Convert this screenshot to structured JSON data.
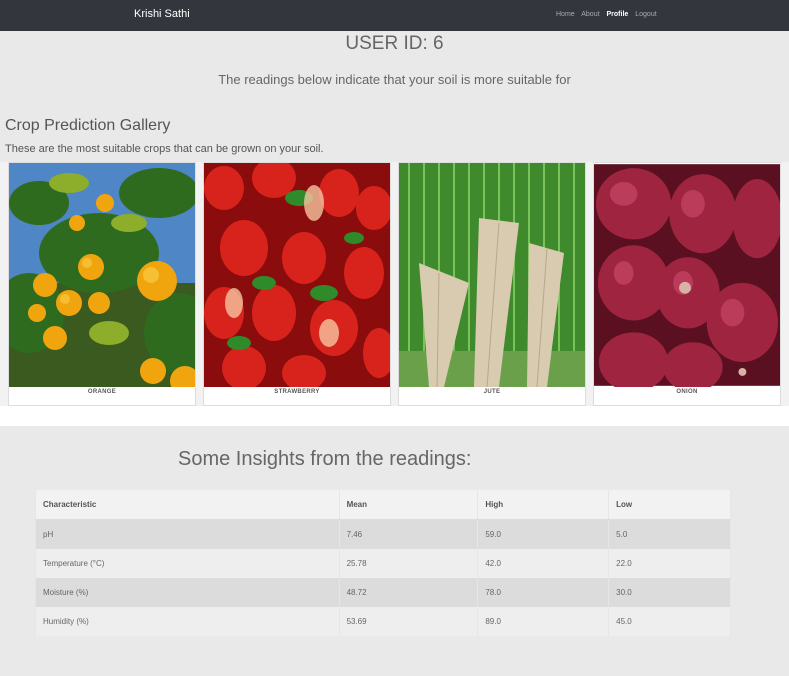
{
  "navbar": {
    "brand": "Krishi Sathi",
    "links": [
      "Home",
      "About",
      "Profile",
      "Logout"
    ],
    "active": "Profile"
  },
  "header": {
    "user_id": "USER ID: 6",
    "subline": "The readings below indicate that your soil is more suitable for"
  },
  "gallery": {
    "title": "Crop Prediction Gallery",
    "description": "These are the most suitable crops that can be grown on your soil.",
    "items": [
      {
        "caption": "ORANGE",
        "icon": "orange-image"
      },
      {
        "caption": "STRAWBERRY",
        "icon": "strawberry-image"
      },
      {
        "caption": "JUTE",
        "icon": "jute-image"
      },
      {
        "caption": "ONION",
        "icon": "onion-image"
      }
    ]
  },
  "insights": {
    "title": "Some Insights from the readings:",
    "columns": [
      "Characteristic",
      "Mean",
      "High",
      "Low"
    ],
    "rows": [
      [
        "pH",
        "7.46",
        "59.0",
        "5.0"
      ],
      [
        "Temperature (°C)",
        "25.78",
        "42.0",
        "22.0"
      ],
      [
        "Moisture (%)",
        "48.72",
        "78.0",
        "30.0"
      ],
      [
        "Humidity (%)",
        "53.69",
        "89.0",
        "45.0"
      ]
    ]
  },
  "colors": {
    "navbar": "#33363d",
    "page_bg": "#e9e9e9",
    "row_odd": "#dcdcdc",
    "row_even": "#eeeeee"
  }
}
